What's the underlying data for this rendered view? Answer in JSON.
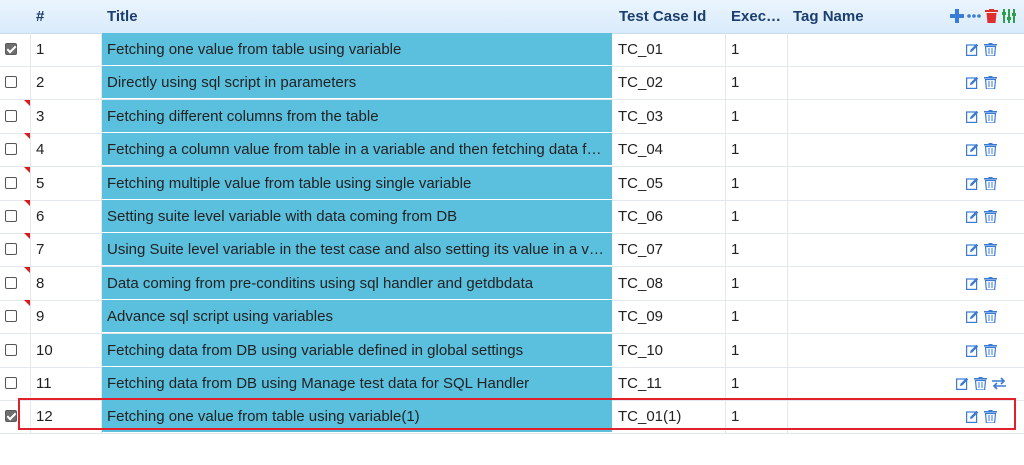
{
  "header": {
    "num": "#",
    "title": "Title",
    "tc_id": "Test Case Id",
    "exec": "Exec…",
    "tag": "Tag Name"
  },
  "header_icons": [
    "plus-icon",
    "more-icon",
    "trash-icon",
    "settings-icon"
  ],
  "colors": {
    "title_bg": "#5bc0de",
    "header_text": "#1a3e6e",
    "icon_blue": "#3a7bd5",
    "delete_red": "#e02d2d",
    "highlight": "#e0202a"
  },
  "rows": [
    {
      "num": "1",
      "title": "Fetching one value from table using variable",
      "tc": "TC_01",
      "exec": "1",
      "checked": true,
      "flag": false
    },
    {
      "num": "2",
      "title": "Directly using sql script in parameters",
      "tc": "TC_02",
      "exec": "1",
      "checked": false,
      "flag": false
    },
    {
      "num": "3",
      "title": "Fetching different columns from the table",
      "tc": "TC_03",
      "exec": "1",
      "checked": false,
      "flag": true
    },
    {
      "num": "4",
      "title": "Fetching a column value from table in a variable and then fetching data fr…",
      "tc": "TC_04",
      "exec": "1",
      "checked": false,
      "flag": true
    },
    {
      "num": "5",
      "title": "Fetching multiple value from table using single variable",
      "tc": "TC_05",
      "exec": "1",
      "checked": false,
      "flag": true
    },
    {
      "num": "6",
      "title": "Setting suite level variable with data coming from DB",
      "tc": "TC_06",
      "exec": "1",
      "checked": false,
      "flag": true
    },
    {
      "num": "7",
      "title": "Using Suite level variable in the test case and also setting its value in a v…",
      "tc": "TC_07",
      "exec": "1",
      "checked": false,
      "flag": true
    },
    {
      "num": "8",
      "title": "Data coming from pre-conditins using sql handler and getdbdata",
      "tc": "TC_08",
      "exec": "1",
      "checked": false,
      "flag": true
    },
    {
      "num": "9",
      "title": "Advance sql script using variables",
      "tc": "TC_09",
      "exec": "1",
      "checked": false,
      "flag": true
    },
    {
      "num": "10",
      "title": "Fetching data from DB using variable defined in global settings",
      "tc": "TC_10",
      "exec": "1",
      "checked": false,
      "flag": false
    },
    {
      "num": "11",
      "title": "Fetching data from DB using Manage test data for SQL Handler",
      "tc": "TC_11",
      "exec": "1",
      "checked": false,
      "flag": false,
      "extra_icon": "swap-icon"
    },
    {
      "num": "12",
      "title": "Fetching one value from table using variable(1)",
      "tc": "TC_01(1)",
      "exec": "1",
      "checked": true,
      "flag": false,
      "highlighted": true
    }
  ]
}
